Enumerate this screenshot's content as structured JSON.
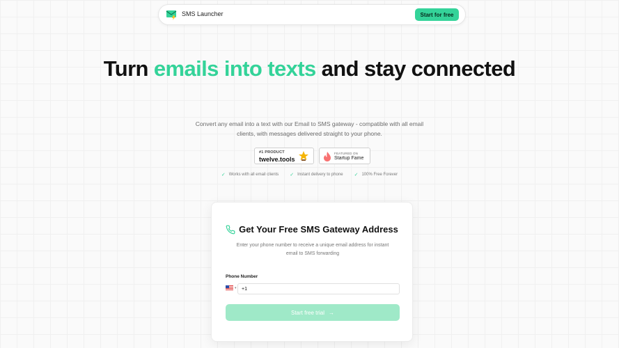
{
  "nav": {
    "brand": "SMS Launcher",
    "cta_label": "Start for free",
    "logo_icon": "envelope-bolt-icon"
  },
  "hero": {
    "title_part1": "Turn ",
    "title_accent": "emails into texts",
    "title_part2": " and stay connected",
    "subtitle": "Convert any email into a text with our Email to SMS gateway - compatible with all email clients, with messages delivered straight to your phone."
  },
  "badges": {
    "twelve": {
      "small": "#1 PRODUCT",
      "big": "twelve.tools",
      "icon": "star-trophy-icon"
    },
    "startup": {
      "small": "FEATURED ON",
      "big": "Startup Fame",
      "icon": "flame-icon"
    }
  },
  "features": [
    {
      "label": "Works with all email clients"
    },
    {
      "label": "Instant delivery to phone"
    },
    {
      "label": "100% Free Forever"
    }
  ],
  "card": {
    "title": "Get Your Free SMS Gateway Address",
    "subtitle": "Enter your phone number to receive a unique email address for instant email to SMS forwarding",
    "phone_label": "Phone Number",
    "phone_value": "+1",
    "trial_label": "Start free trial",
    "trial_arrow": "→",
    "flag_icon": "us-flag-icon"
  },
  "colors": {
    "accent": "#34d399",
    "button_disabled": "#9fe9c8"
  }
}
